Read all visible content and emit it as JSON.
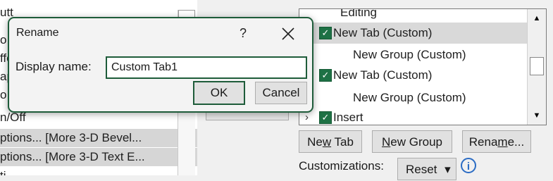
{
  "background_left": {
    "items": [
      {
        "label": "utt"
      },
      {
        "label": "o"
      },
      {
        "label": "ffe"
      },
      {
        "label": "ap"
      },
      {
        "label": "o"
      },
      {
        "label": "n/Off"
      },
      {
        "label": "ptions... [More 3-D Bevel..."
      },
      {
        "label": "ptions... [More 3-D Text E..."
      },
      {
        "label": "ti"
      }
    ]
  },
  "ribbon_tree": {
    "items": [
      {
        "label": "Editing",
        "checked": false,
        "expanded": false
      },
      {
        "label": "New Tab (Custom)",
        "checked": true,
        "selected": true
      },
      {
        "label": "New Group (Custom)"
      },
      {
        "label": "New Tab (Custom)",
        "checked": true
      },
      {
        "label": "New Group (Custom)"
      },
      {
        "label": "Insert",
        "checked": true
      }
    ],
    "scroll_up_icon": "triangle-up",
    "scroll_down_icon": "triangle-down"
  },
  "buttons": {
    "new_tab": {
      "pre": "Ne",
      "key": "w",
      "post": " Tab"
    },
    "new_group": {
      "pre": "",
      "key": "N",
      "post": "ew Group"
    },
    "rename": {
      "pre": "Rena",
      "key": "m",
      "post": "e..."
    }
  },
  "customizations": {
    "label": "Customizations:",
    "reset_label": "Reset",
    "reset_arrow": "▾",
    "info_icon": "i"
  },
  "rename_dialog": {
    "title": "Rename",
    "help": "?",
    "close": "✕",
    "display_name_label": "Display name:",
    "display_name_value": "Custom Tab1",
    "ok_label": "OK",
    "cancel_label": "Cancel"
  },
  "colors": {
    "accent": "#1e5c3a",
    "checkbox": "#1e7145",
    "info": "#2b6cc4"
  }
}
